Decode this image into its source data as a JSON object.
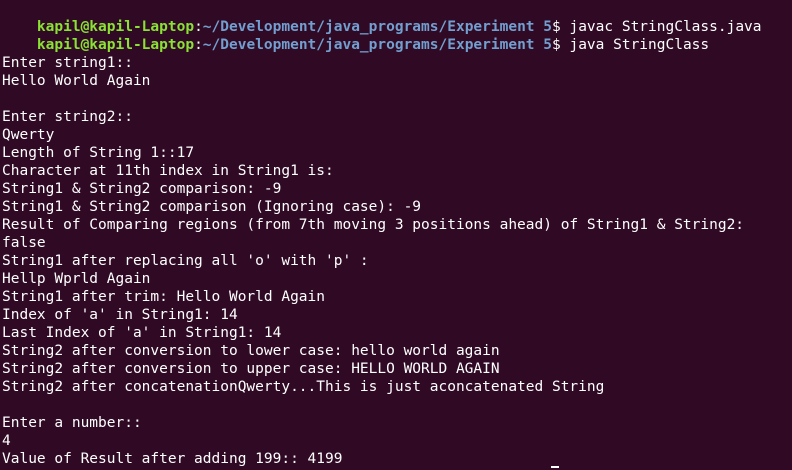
{
  "prompt": {
    "user_host": "kapil@kapil-Laptop",
    "sep": ":",
    "cwd": "~/Development/java_programs/Experiment 5",
    "symbol": "$"
  },
  "commands": [
    " javac StringClass.java",
    " java StringClass"
  ],
  "output": [
    "",
    "Enter string1::",
    "Hello World Again",
    "",
    "Enter string2::",
    "Qwerty",
    "Length of String 1::17",
    "Character at 11th index in String1 is:",
    "String1 & String2 comparison: -9",
    "String1 & String2 comparison (Ignoring case): -9",
    "Result of Comparing regions (from 7th moving 3 positions ahead) of String1 & String2:",
    "false",
    "String1 after replacing all 'o' with 'p' :",
    "Hellp Wprld Again",
    "String1 after trim: Hello World Again",
    "Index of 'a' in String1: 14",
    "Last Index of 'a' in String1: 14",
    "String2 after conversion to lower case: hello world again",
    "String2 after conversion to upper case: HELLO WORLD AGAIN",
    "String2 after concatenationQwerty...This is just aconcatenated String",
    "",
    "Enter a number::",
    "4",
    "Value of Result after adding 199:: 4199"
  ]
}
